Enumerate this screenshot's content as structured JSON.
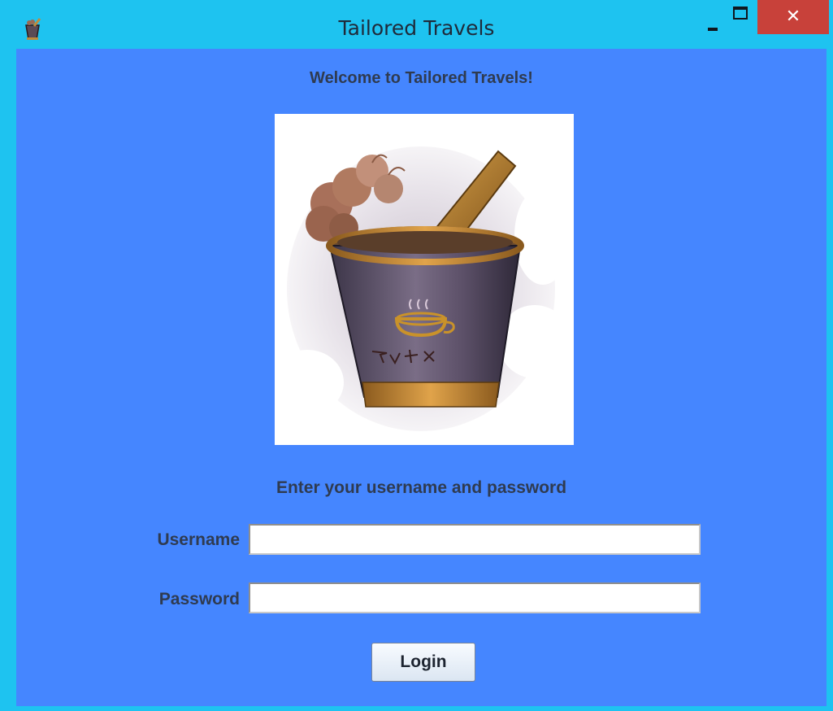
{
  "window": {
    "title": "Tailored Travels",
    "close_glyph": "✕",
    "icons": [
      "app-icon",
      "minimize-icon",
      "maximize-icon",
      "close-icon"
    ]
  },
  "main": {
    "welcome": "Welcome to Tailored Travels!",
    "prompt": "Enter your username and password",
    "username_label": "Username",
    "username_value": "",
    "password_label": "Password",
    "password_value": "",
    "login_label": "Login"
  },
  "colors": {
    "titlebar": "#1ec3f0",
    "panel": "#4586ff",
    "close_button": "#c8413a",
    "text": "#2f3b50"
  }
}
